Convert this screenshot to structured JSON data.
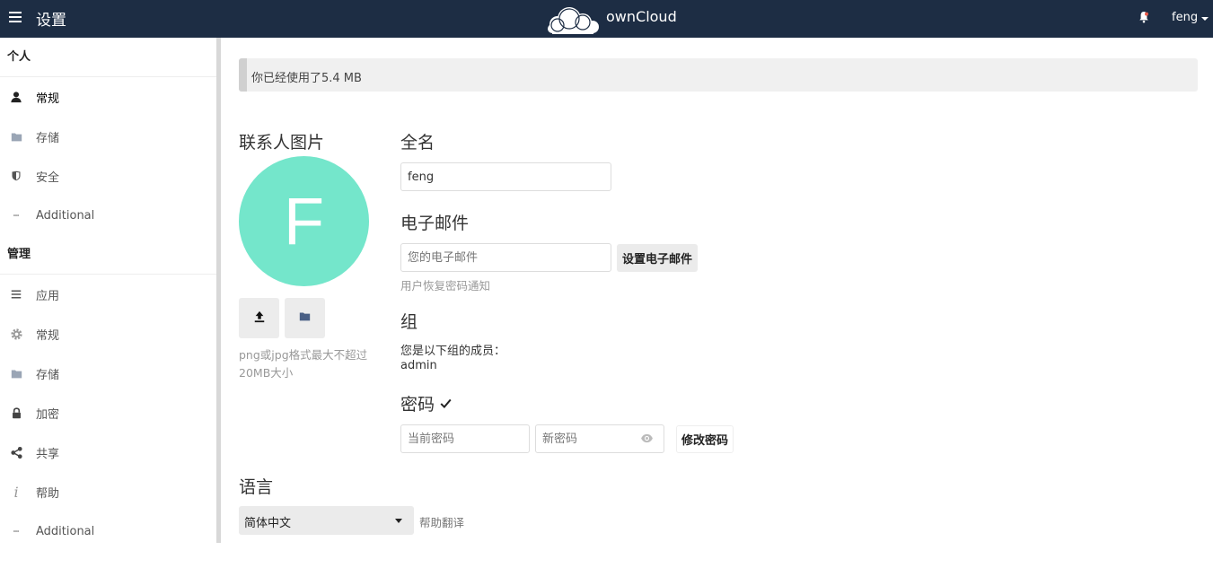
{
  "header": {
    "app_title": "设置",
    "logo_text": "ownCloud",
    "user_name": "feng",
    "icons": {
      "menu": "menu-icon",
      "logo": "owncloud-logo",
      "bell": "bell-icon"
    }
  },
  "sidebar": {
    "personal_heading": "个人",
    "personal_items": [
      {
        "label": "常规",
        "icon": "user-icon"
      },
      {
        "label": "存储",
        "icon": "folder-icon"
      },
      {
        "label": "安全",
        "icon": "shield-icon"
      },
      {
        "label": "Additional",
        "icon": "more-icon"
      }
    ],
    "admin_heading": "管理",
    "admin_items": [
      {
        "label": "应用",
        "icon": "list-icon"
      },
      {
        "label": "常规",
        "icon": "gear-icon"
      },
      {
        "label": "存储",
        "icon": "folder-icon"
      },
      {
        "label": "加密",
        "icon": "lock-icon"
      },
      {
        "label": "共享",
        "icon": "share-icon"
      },
      {
        "label": "帮助",
        "icon": "info-icon"
      },
      {
        "label": "Additional",
        "icon": "more-icon"
      }
    ]
  },
  "quota": {
    "text": "你已经使用了5.4 MB",
    "used_fraction": 0.008
  },
  "avatar": {
    "heading": "联系人图片",
    "initial": "F",
    "color": "#74e6cb",
    "upload_icon": "upload-icon",
    "choose_icon": "folder-icon",
    "hint": "png或jpg格式最大不超过20MB大小"
  },
  "fullname": {
    "heading": "全名",
    "value": "feng"
  },
  "email": {
    "heading": "电子邮件",
    "placeholder": "您的电子邮件",
    "button": "设置电子邮件",
    "note": "用户恢复密码通知"
  },
  "groups": {
    "heading": "组",
    "intro": "您是以下组的成员：",
    "list": "admin"
  },
  "password": {
    "heading": "密码",
    "check_icon": "check-icon",
    "current_placeholder": "当前密码",
    "new_placeholder": "新密码",
    "eye_icon": "eye-icon",
    "button": "修改密码"
  },
  "language": {
    "heading": "语言",
    "selected": "简体中文",
    "help_link": "帮助翻译"
  },
  "colors": {
    "header_bg": "#1d2d44",
    "avatar": "#74e6cb",
    "quota_bg": "#f0f0f0"
  }
}
